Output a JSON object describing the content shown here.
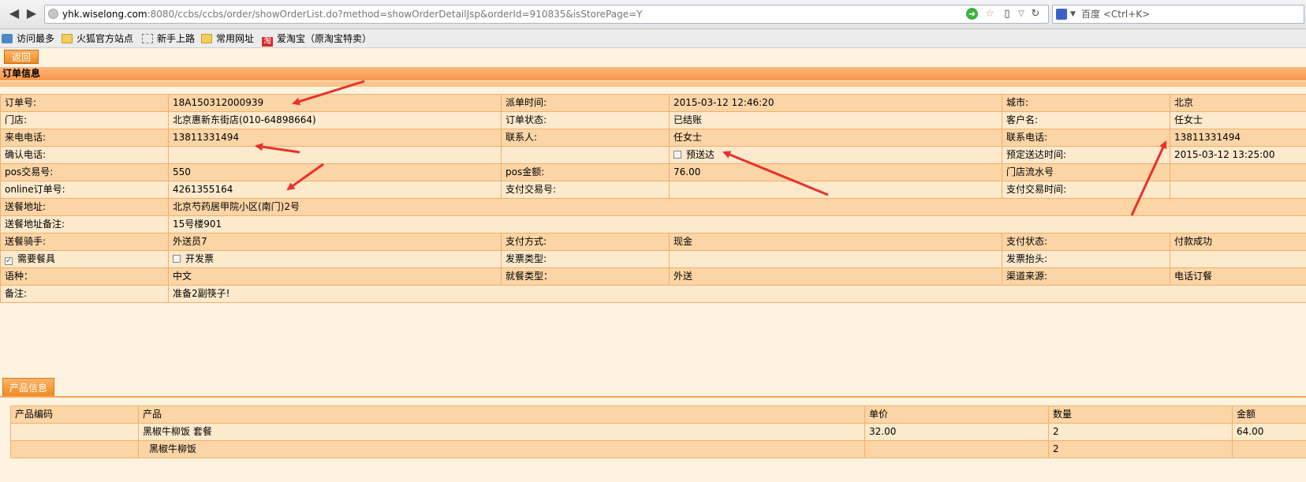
{
  "browser": {
    "url_host": "yhk.wiselong.com",
    "url_rest": ":8080/ccbs/ccbs/order/showOrderList.do?method=showOrderDetailJsp&orderId=910835&isStorePage=Y",
    "search_placeholder": "百度 <Ctrl+K>",
    "bookmarks": [
      "访问最多",
      "火狐官方站点",
      "新手上路",
      "常用网址",
      "爱淘宝（原淘宝特卖）"
    ]
  },
  "page": {
    "back_label": "返回",
    "order_section_title": "订单信息",
    "product_tab_label": "产品信息"
  },
  "order": {
    "order_no_label": "订单号:",
    "order_no": "18A150312000939",
    "dispatch_time_label": "派单时间:",
    "dispatch_time": "2015-03-12 12:46:20",
    "city_label": "城市:",
    "city": "北京",
    "store_label": "门店:",
    "store": "北京惠新东街店(010-64898664)",
    "status_label": "订单状态:",
    "status": "已结账",
    "customer_label": "客户名:",
    "customer": "任女士",
    "caller_phone_label": "来电电话:",
    "caller_phone": "13811331494",
    "contact_label": "联系人:",
    "contact": "任女士",
    "contact_phone_label": "联系电话:",
    "contact_phone": "13811331494",
    "confirm_phone_label": "确认电话:",
    "preorder_label": "预送达",
    "scheduled_time_label": "预定送达时间:",
    "scheduled_time": "2015-03-12 13:25:00",
    "pos_no_label": "pos交易号:",
    "pos_no": "550",
    "pos_amount_label": "pos金额:",
    "pos_amount": "76.00",
    "store_serial_label": "门店流水号",
    "online_no_label": "online订单号:",
    "online_no": "4261355164",
    "pay_trans_no_label": "支付交易号:",
    "pay_trans_time_label": "支付交易时间:",
    "address_label": "送餐地址:",
    "address": "北京芍药居甲院小区(南门)2号",
    "address_note_label": "送餐地址备注:",
    "address_note": "15号楼901",
    "rider_label": "送餐骑手:",
    "rider": "外送员7",
    "pay_method_label": "支付方式:",
    "pay_method": "现金",
    "pay_status_label": "支付状态:",
    "pay_status": "付款成功",
    "need_tableware_label": "需要餐具",
    "invoice_label": "开发票",
    "invoice_type_label": "发票类型:",
    "invoice_title_label": "发票抬头:",
    "language_label": "语种：",
    "language": "中文",
    "dining_type_label": "就餐类型：",
    "dining_type": "外送",
    "channel_label": "渠道来源:",
    "channel": "电话订餐",
    "remark_label": "备注:",
    "remark": "准备2副筷子!"
  },
  "products": {
    "headers": [
      "产品编码",
      "产品",
      "单价",
      "数量",
      "金额"
    ],
    "rows": [
      {
        "code": "",
        "name": "黑椒牛柳饭 套餐",
        "price": "32.00",
        "qty": "2",
        "amount": "64.00"
      },
      {
        "code": "",
        "name": "黑椒牛柳饭",
        "price": "",
        "qty": "2",
        "amount": ""
      }
    ]
  },
  "colors": {
    "accent": "#f08a22",
    "row_dark": "#fbd5a6",
    "row_light": "#fde9cc",
    "annotation_arrow": "#e8322a"
  }
}
